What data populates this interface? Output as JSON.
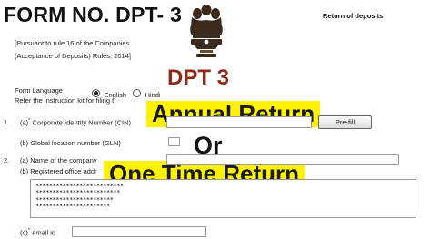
{
  "header": {
    "form_title": "FORM NO. DPT- 3",
    "return_of_deposits": "Return of deposits",
    "pursuant_line1": "[Pursuant to rule 16 of the Companies",
    "pursuant_line2": "(Acceptance of Deposits) Rules, 2014]"
  },
  "overlay": {
    "dpt3": "DPT 3",
    "annual_return": "Annual Return",
    "or": "Or",
    "one_time_return": "One Time Return",
    "colors": {
      "dpt3": "#8b2b1b",
      "highlight": "#fff200"
    }
  },
  "form_language": {
    "label": "Form Language",
    "options": [
      {
        "label": "English",
        "selected": true
      },
      {
        "label": "Hindi",
        "selected": false
      }
    ],
    "instruction": "Refer the instruction kit for filing t"
  },
  "fields": {
    "item1_num": "1.",
    "item1a_label_prefix": "(a)",
    "item1a_label": "Corporate Identity Number (CIN)",
    "cin_value": "*********************",
    "prefill_label": "Pre-fill",
    "item1b_label": "(b) Global location number (GLN)",
    "item2_num": "2.",
    "item2a_label": "(a) Name of the company",
    "company_name_value": "************************",
    "item2b_label": "(b) Registered office addr",
    "address_lines": [
      "**************************",
      "*************************",
      "***********************",
      "**********************"
    ],
    "email_label_prefix": "(c)",
    "email_label": "email id",
    "email_value": "**********************",
    "required_marker": "*"
  }
}
